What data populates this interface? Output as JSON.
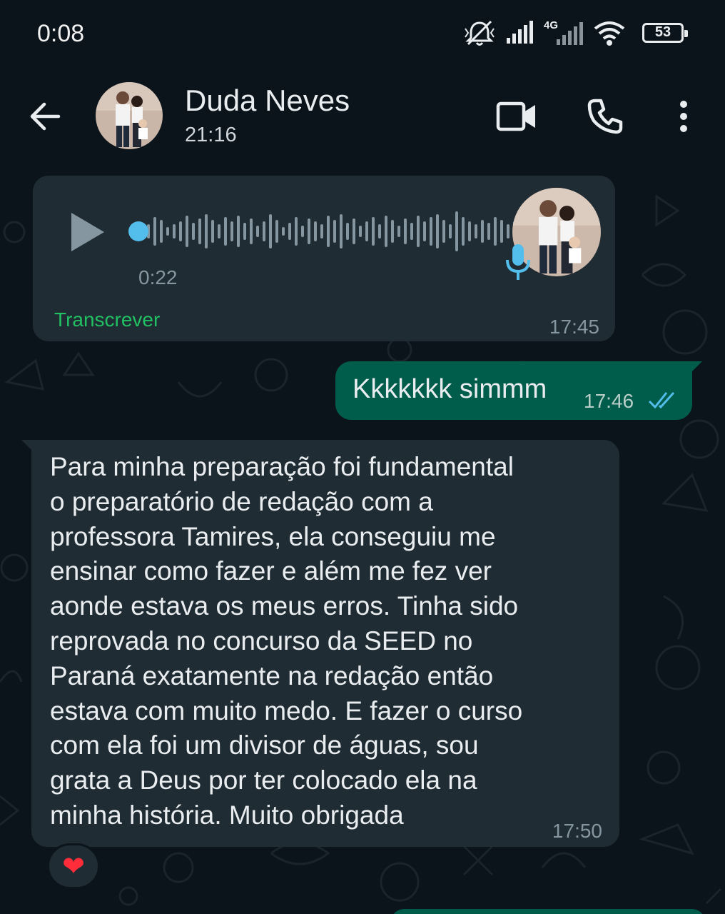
{
  "status_bar": {
    "time": "0:08",
    "network": "4G",
    "battery": "53",
    "icons": [
      "mute-icon",
      "signal-icon",
      "signal-4g-icon",
      "wifi-icon",
      "battery-icon"
    ]
  },
  "header": {
    "contact_name": "Duda Neves",
    "subtitle": "21:16",
    "icons": [
      "back-arrow-icon",
      "video-call-icon",
      "phone-icon",
      "more-vert-icon"
    ]
  },
  "messages": [
    {
      "type": "voice",
      "direction": "incoming",
      "duration": "0:22",
      "action": "Transcrever",
      "time": "17:45"
    },
    {
      "type": "text",
      "direction": "outgoing",
      "text": "Kkkkkkk simmm",
      "time": "17:46",
      "status": "read"
    },
    {
      "type": "text",
      "direction": "incoming",
      "text": "Para minha preparação foi fundamental\no preparatório de redação com a\nprofessora Tamires, ela conseguiu me\nensinar como fazer e além me fez ver\naonde estava os meus erros. Tinha sido\nreprovada no concurso da SEED no\nParaná exatamente na redação então\nestava com muito medo. E fazer o curso\ncom ela foi um divisor de águas, sou\ngrata a Deus por ter colocado ela na\nminha história. Muito obrigada",
      "time": "17:50",
      "reaction": "❤"
    }
  ],
  "colors": {
    "background": "#0b141a",
    "incoming_bubble": "#202c33",
    "outgoing_bubble": "#005c4b",
    "accent_green": "#21c063",
    "read_ticks": "#53bdeb"
  }
}
